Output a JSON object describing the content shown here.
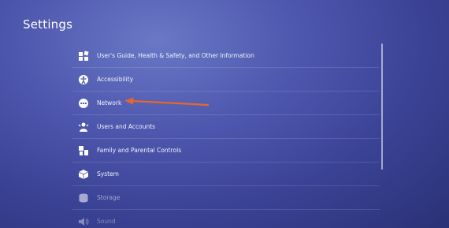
{
  "header": {
    "title": "Settings"
  },
  "menu": {
    "items": [
      {
        "label": "User's Guide, Health & Safety, and Other Information",
        "icon": "guide-icon"
      },
      {
        "label": "Accessibility",
        "icon": "accessibility-icon"
      },
      {
        "label": "Network",
        "icon": "network-icon"
      },
      {
        "label": "Users and Accounts",
        "icon": "users-icon"
      },
      {
        "label": "Family and Parental Controls",
        "icon": "family-icon"
      },
      {
        "label": "System",
        "icon": "system-icon"
      },
      {
        "label": "Storage",
        "icon": "storage-icon"
      },
      {
        "label": "Sound",
        "icon": "sound-icon"
      }
    ]
  },
  "annotation": {
    "color": "#e8662c"
  },
  "colors": {
    "background": "#4d57ad",
    "text": "#ffffff"
  }
}
